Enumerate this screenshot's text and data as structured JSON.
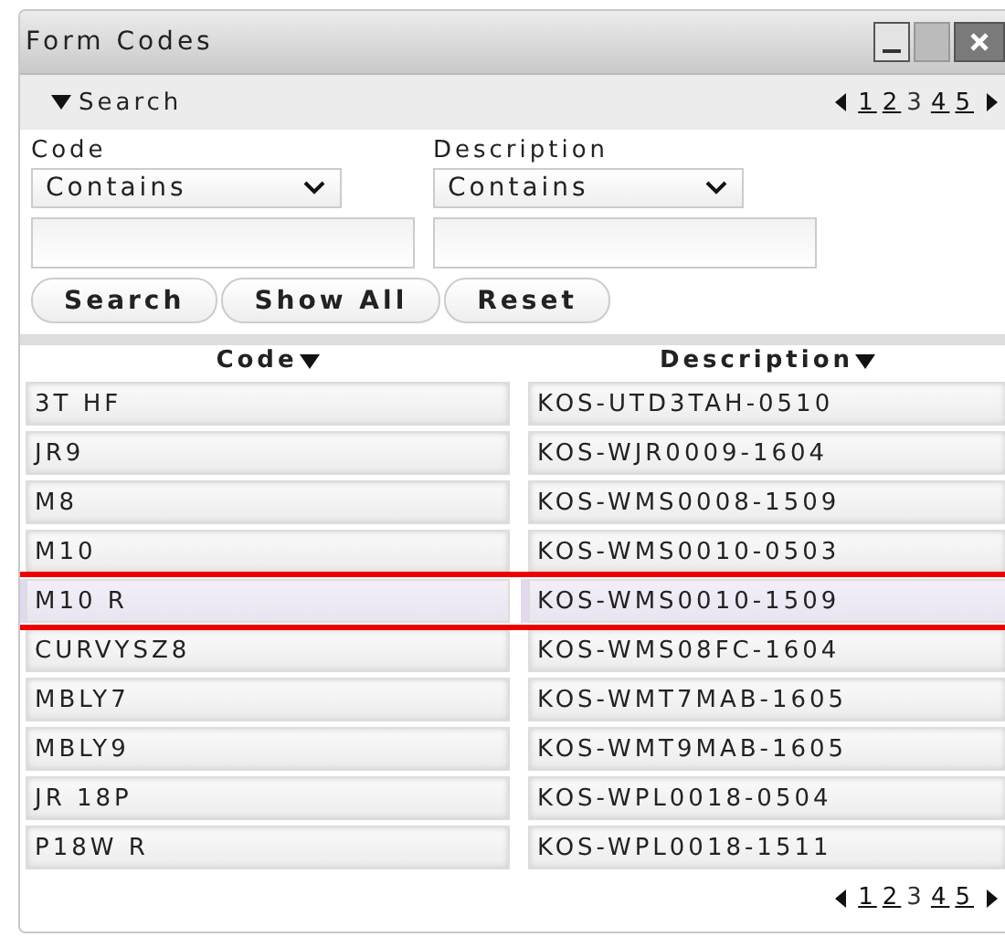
{
  "window": {
    "title": "Form Codes"
  },
  "search_toggle": {
    "label": "Search",
    "expanded": true
  },
  "pager_top": [
    {
      "label": "1",
      "selected": false
    },
    {
      "label": "2",
      "selected": false
    },
    {
      "label": "3",
      "selected": true
    },
    {
      "label": "4",
      "selected": false
    },
    {
      "label": "5",
      "selected": false
    }
  ],
  "filters": [
    {
      "label": "Code",
      "operator": "Contains"
    },
    {
      "label": "Description",
      "operator": "Contains"
    }
  ],
  "buttons": [
    "Search",
    "Show All",
    "Reset"
  ],
  "table": {
    "columns": [
      "Code",
      "Description"
    ],
    "rows": [
      {
        "cells": [
          "3T HF",
          "KOS-UTD3TAH-0510"
        ],
        "selected": false,
        "annotated": false
      },
      {
        "cells": [
          "JR9",
          "KOS-WJR0009-1604"
        ],
        "selected": false,
        "annotated": false
      },
      {
        "cells": [
          "M8",
          "KOS-WMS0008-1509"
        ],
        "selected": false,
        "annotated": false
      },
      {
        "cells": [
          "M10",
          "KOS-WMS0010-0503"
        ],
        "selected": false,
        "annotated": false
      },
      {
        "cells": [
          "M10 R",
          "KOS-WMS0010-1509"
        ],
        "selected": true,
        "annotated": true
      },
      {
        "cells": [
          "CURVYSZ8",
          "KOS-WMS08FC-1604"
        ],
        "selected": false,
        "annotated": false
      },
      {
        "cells": [
          "MBLY7",
          "KOS-WMT7MAB-1605"
        ],
        "selected": false,
        "annotated": false
      },
      {
        "cells": [
          "MBLY9",
          "KOS-WMT9MAB-1605"
        ],
        "selected": false,
        "annotated": false
      },
      {
        "cells": [
          "JR 18P",
          "KOS-WPL0018-0504"
        ],
        "selected": false,
        "annotated": false
      },
      {
        "cells": [
          "P18W R",
          "KOS-WPL0018-1511"
        ],
        "selected": false,
        "annotated": false
      }
    ]
  },
  "pager_bottom": [
    {
      "label": "1",
      "selected": false
    },
    {
      "label": "2",
      "selected": false
    },
    {
      "label": "3",
      "selected": true
    },
    {
      "label": "4",
      "selected": false
    },
    {
      "label": "5",
      "selected": false
    }
  ]
}
